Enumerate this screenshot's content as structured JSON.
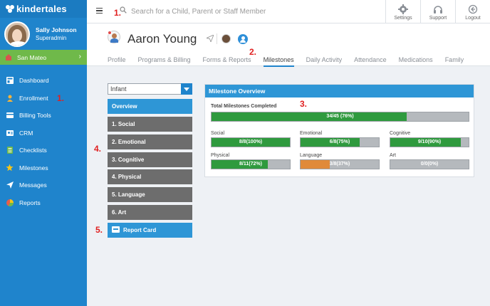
{
  "brand": {
    "name": "kindertales",
    "colors": {
      "primary": "#1f84cc",
      "accent": "#2e96d6",
      "success": "#2f9a3e",
      "warning": "#e08a3a",
      "location": "#6fb94a",
      "annotation": "#e02020"
    }
  },
  "user": {
    "name": "Sally Johnson",
    "role": "Superadmin"
  },
  "location": {
    "name": "San Mateo",
    "chevron": "›"
  },
  "sidebar": {
    "items": [
      {
        "label": "Dashboard",
        "icon": "dashboard-icon"
      },
      {
        "label": "Enrollment",
        "icon": "person-icon",
        "annotation": "1."
      },
      {
        "label": "Billing Tools",
        "icon": "billing-icon"
      },
      {
        "label": "CRM",
        "icon": "crm-icon"
      },
      {
        "label": "Checklists",
        "icon": "checklist-icon"
      },
      {
        "label": "Milestones",
        "icon": "star-icon"
      },
      {
        "label": "Messages",
        "icon": "send-icon"
      },
      {
        "label": "Reports",
        "icon": "pie-icon"
      }
    ]
  },
  "header": {
    "search_placeholder": "Search for a Child, Parent or Staff Member",
    "annotation": "1.",
    "buttons": [
      {
        "label": "Settings",
        "icon": "gear-icon"
      },
      {
        "label": "Support",
        "icon": "headset-icon"
      },
      {
        "label": "Logout",
        "icon": "logout-icon"
      }
    ]
  },
  "child": {
    "name": "Aaron Young",
    "tabs": [
      "Profile",
      "Programs & Billing",
      "Forms & Reports",
      "Milestones",
      "Daily Activity",
      "Attendance",
      "Medications",
      "Family"
    ],
    "active_tab": "Milestones",
    "tabs_annotation": "2."
  },
  "milestones": {
    "age_group": "Infant",
    "menu": [
      "Overview",
      "1. Social",
      "2. Emotional",
      "3. Cognitive",
      "4. Physical",
      "5. Language",
      "6. Art"
    ],
    "menu_annotation": "4.",
    "report_card_label": "Report Card",
    "report_annotation": "5.",
    "panel_title": "Milestone Overview",
    "panel_annotation": "3.",
    "total": {
      "label": "Total Milestones Completed",
      "text": "34/45 (76%)",
      "percent": 76
    },
    "categories": [
      {
        "label": "Social",
        "text": "8/8(100%)",
        "percent": 100,
        "status": "success"
      },
      {
        "label": "Emotional",
        "text": "6/8(75%)",
        "percent": 75,
        "status": "success"
      },
      {
        "label": "Cognitive",
        "text": "9/10(90%)",
        "percent": 90,
        "status": "success"
      },
      {
        "label": "Physical",
        "text": "8/11(72%)",
        "percent": 72,
        "status": "success"
      },
      {
        "label": "Language",
        "text": "3/8(37%)",
        "percent": 37,
        "status": "warning"
      },
      {
        "label": "Art",
        "text": "0/0(0%)",
        "percent": 0,
        "status": "none"
      }
    ]
  }
}
